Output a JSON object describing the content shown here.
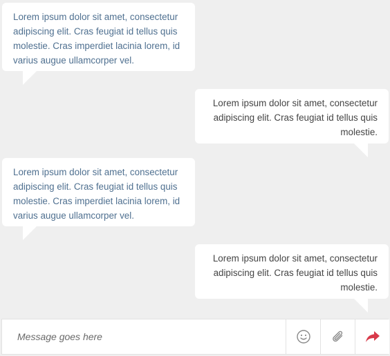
{
  "messages": [
    {
      "direction": "incoming",
      "text": "Lorem ipsum dolor sit amet, consectetur adipiscing elit. Cras feugiat id tellus quis molestie. Cras imperdiet lacinia lorem, id varius augue ullamcorper vel."
    },
    {
      "direction": "outgoing",
      "text": "Lorem ipsum dolor sit amet, consectetur adipiscing elit. Cras feugiat id tellus quis molestie."
    },
    {
      "direction": "incoming",
      "text": "Lorem ipsum dolor sit amet, consectetur adipiscing elit. Cras feugiat id tellus quis molestie. Cras imperdiet lacinia lorem, id varius augue ullamcorper vel."
    },
    {
      "direction": "outgoing",
      "text": "Lorem ipsum dolor sit amet, consectetur adipiscing elit. Cras feugiat id tellus quis molestie."
    }
  ],
  "composer": {
    "placeholder": "Message goes here",
    "emoji_icon": "smiley-face-icon",
    "attach_icon": "paperclip-icon",
    "send_icon": "send-arrow-icon"
  },
  "colors": {
    "background": "#efefef",
    "bubble": "#ffffff",
    "incoming_text": "#4f7090",
    "outgoing_text": "#444444",
    "send_accent": "#d83a4a"
  }
}
